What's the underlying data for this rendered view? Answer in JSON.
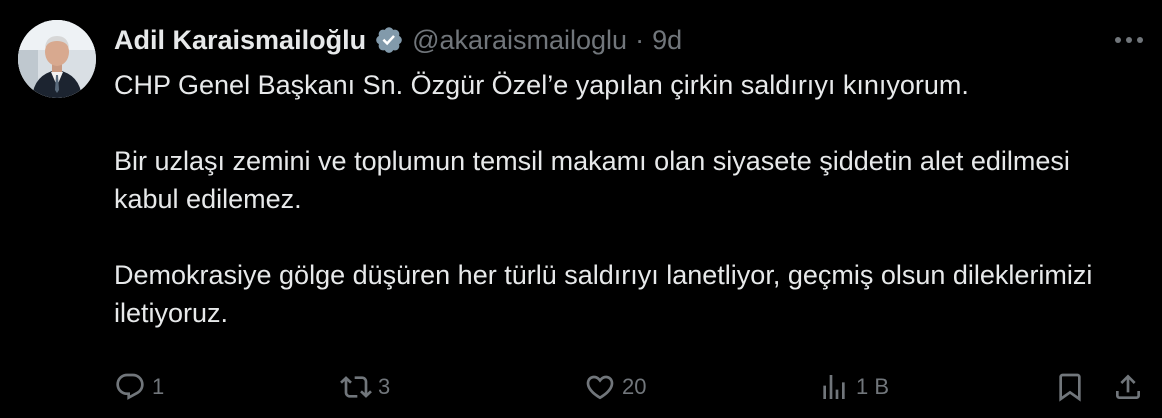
{
  "author": {
    "name": "Adil Karaismailoğlu",
    "handle": "@akaraismailoglu",
    "separator": "·",
    "time": "9d",
    "verified": true,
    "avatar_icon": "profile-photo"
  },
  "tweet": {
    "paragraphs": [
      "CHP Genel Başkanı Sn. Özgür Özel’e yapılan çirkin saldırıyı kınıyorum.",
      "Bir uzlaşı zemini ve toplumun temsil makamı olan siyasete şiddetin alet edilmesi kabul edilemez.",
      "Demokrasiye gölge düşüren her türlü saldırıyı lanetliyor, geçmiş olsun dileklerimizi iletiyoruz."
    ]
  },
  "actions": {
    "reply_count": "1",
    "retweet_count": "3",
    "like_count": "20",
    "views_count": "1 B"
  },
  "colors": {
    "background": "#000000",
    "text_primary": "#e7e9ea",
    "text_secondary": "#71767b",
    "verified_badge": "#829aab"
  }
}
